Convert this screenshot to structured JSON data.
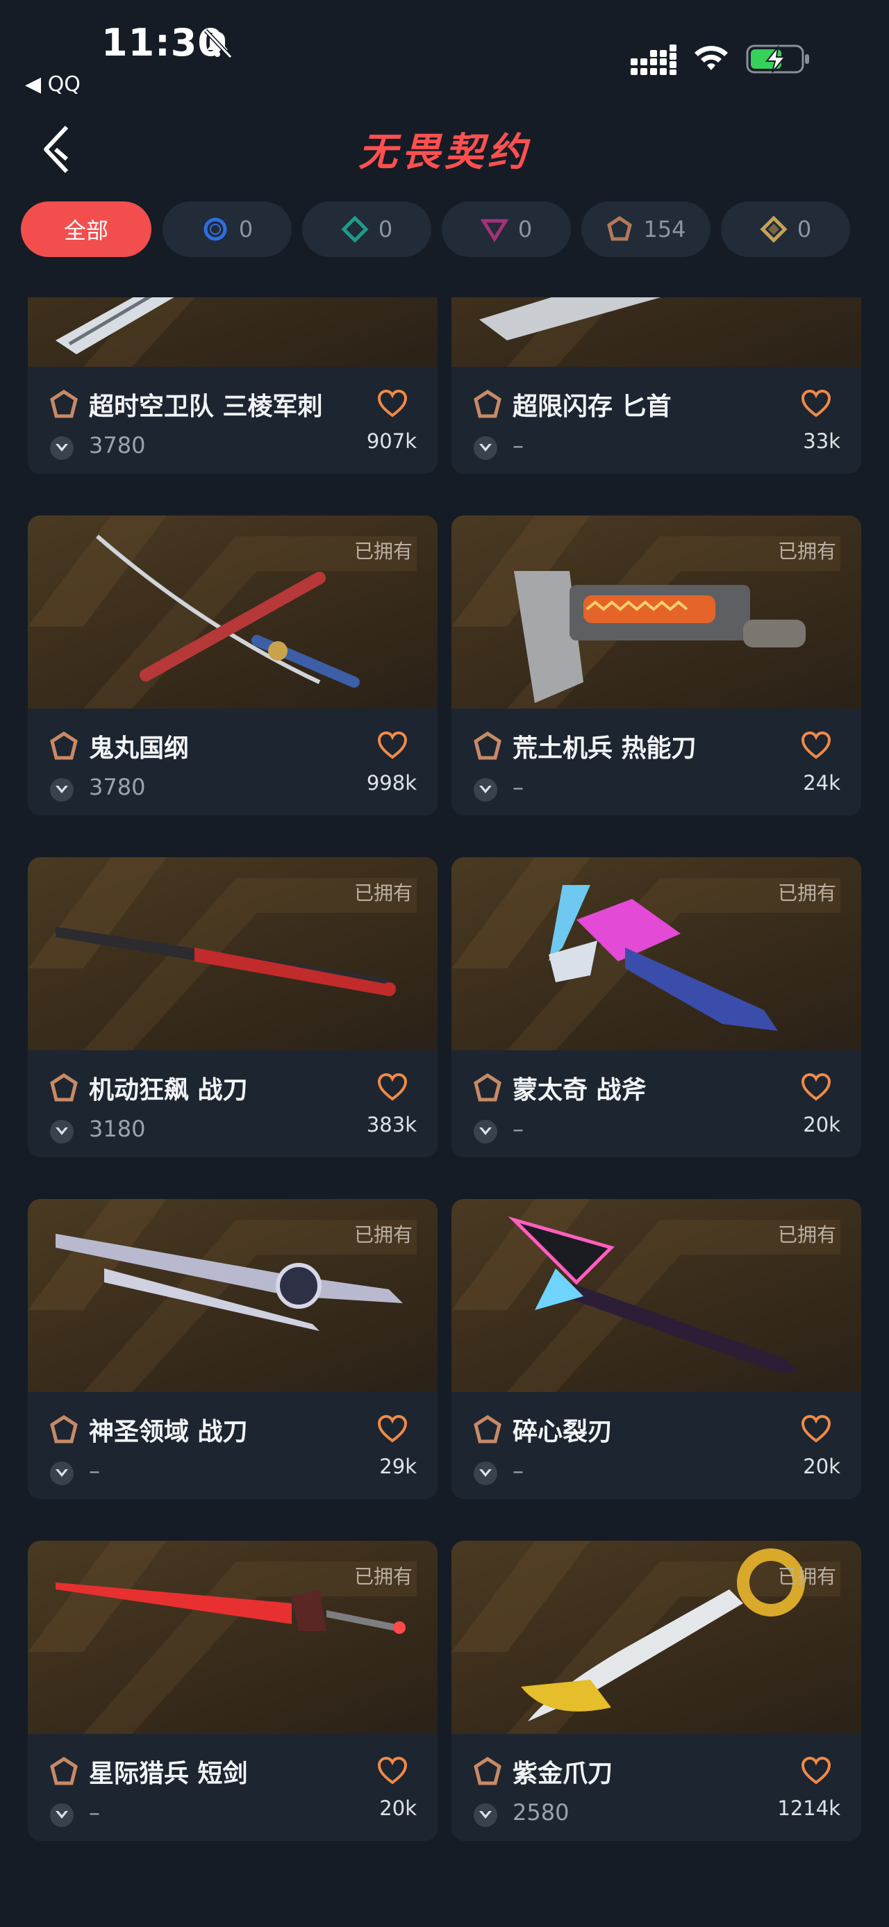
{
  "status_bar": {
    "time": "11:30",
    "back_app": "◀ QQ"
  },
  "header": {
    "title": "无畏契约"
  },
  "filters": [
    {
      "label": "全部",
      "active": true
    },
    {
      "icon": "circle-tier-icon",
      "count": "0",
      "color": "#2f6fe0"
    },
    {
      "icon": "diamond-tier-icon",
      "count": "0",
      "color": "#1f9b8a"
    },
    {
      "icon": "triangle-tier-icon",
      "count": "0",
      "color": "#a4327a"
    },
    {
      "icon": "pentagon-tier-icon",
      "count": "154",
      "color": "#b4785a"
    },
    {
      "icon": "hex-tier-icon",
      "count": "0",
      "color": "#c6a255"
    }
  ],
  "cards": [
    {
      "name": "超时空卫队 三棱军刺",
      "price": "3780",
      "likes": "907k",
      "owned": ""
    },
    {
      "name": "超限闪存 匕首",
      "price": "–",
      "likes": "33k",
      "owned": ""
    },
    {
      "name": "鬼丸国纲",
      "price": "3780",
      "likes": "998k",
      "owned": "已拥有"
    },
    {
      "name": "荒土机兵 热能刀",
      "price": "–",
      "likes": "24k",
      "owned": "已拥有"
    },
    {
      "name": "机动狂飙 战刀",
      "price": "3180",
      "likes": "383k",
      "owned": "已拥有"
    },
    {
      "name": "蒙太奇 战斧",
      "price": "–",
      "likes": "20k",
      "owned": "已拥有"
    },
    {
      "name": "神圣领域 战刀",
      "price": "–",
      "likes": "29k",
      "owned": "已拥有"
    },
    {
      "name": "碎心裂刃",
      "price": "–",
      "likes": "20k",
      "owned": "已拥有"
    },
    {
      "name": "星际猎兵 短剑",
      "price": "–",
      "likes": "20k",
      "owned": "已拥有"
    },
    {
      "name": "紫金爪刀",
      "price": "2580",
      "likes": "1214k",
      "owned": "已拥有"
    }
  ]
}
